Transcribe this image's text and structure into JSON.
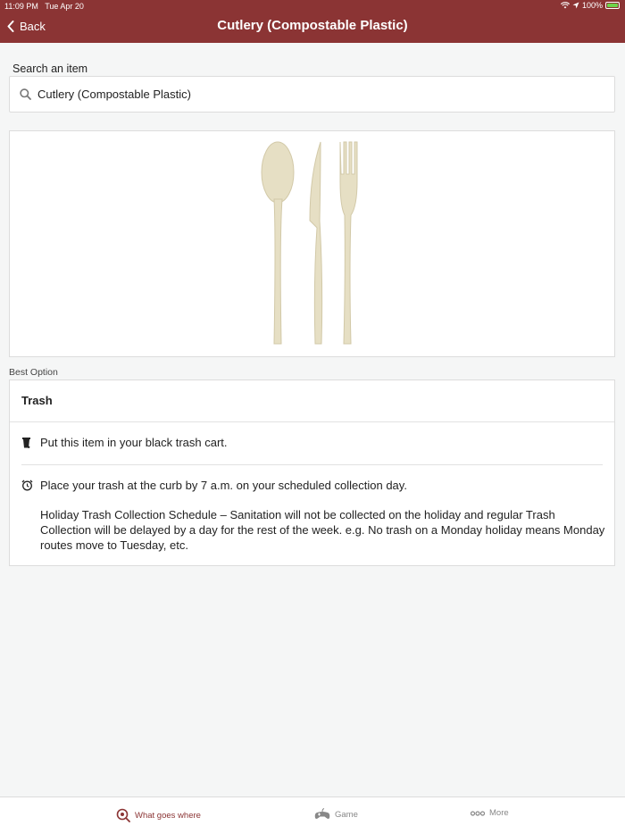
{
  "status_bar": {
    "time": "11:09 PM",
    "date": "Tue Apr 20",
    "battery": "100%",
    "battery_level": 1.0
  },
  "nav": {
    "back_label": "Back",
    "title": "Cutlery (Compostable Plastic)"
  },
  "search": {
    "label": "Search an item",
    "value": "Cutlery (Compostable Plastic)",
    "icon": "search-icon"
  },
  "item_image": {
    "subject": "cutlery-illustration"
  },
  "best_option": {
    "section_label": "Best Option",
    "title": "Trash",
    "instructions": [
      {
        "icon": "trash-can-icon",
        "text": "Put this item in your black trash cart."
      },
      {
        "icon": "alarm-clock-icon",
        "text": "Place your trash at the curb by 7 a.m. on your scheduled collection day."
      }
    ],
    "holiday_note": "Holiday Trash Collection Schedule – Sanitation will not be collected on the holiday and regular Trash Collection will be delayed by a day for the rest of the week. e.g. No trash on a Monday holiday means Monday routes move to Tuesday, etc."
  },
  "tabs": [
    {
      "label": "What goes where",
      "icon": "search-pin-icon",
      "active": true
    },
    {
      "label": "Game",
      "icon": "game-controller-icon",
      "active": false
    },
    {
      "label": "More",
      "icon": "more-icon",
      "active": false
    }
  ],
  "colors": {
    "header": "#8b3434",
    "accent": "#8b3434",
    "background": "#f5f6f6",
    "card": "#ffffff",
    "inactive_tab": "#888888",
    "cutlery": "#e6dfc4"
  }
}
